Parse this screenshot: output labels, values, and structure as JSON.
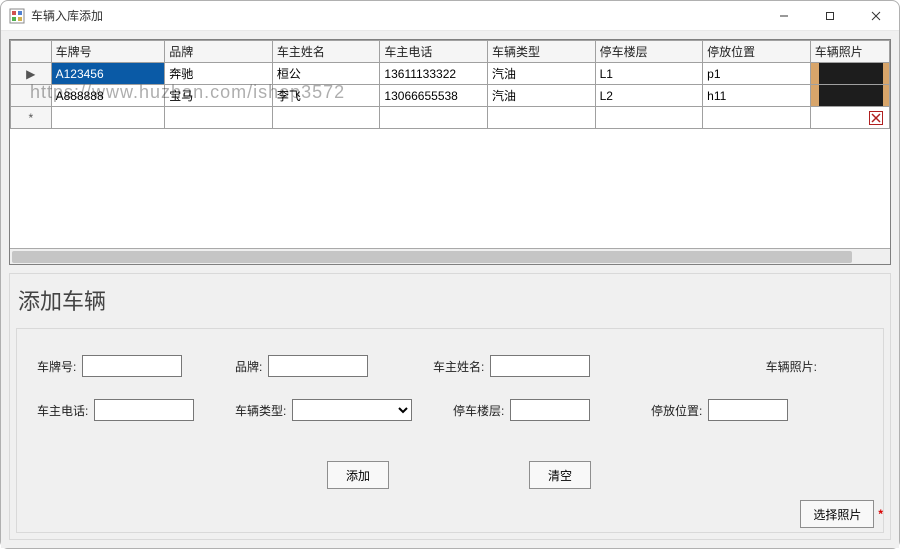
{
  "window": {
    "title": "车辆入库添加"
  },
  "grid": {
    "columns": [
      "车牌号",
      "品牌",
      "车主姓名",
      "车主电话",
      "车辆类型",
      "停车楼层",
      "停放位置",
      "车辆照片"
    ],
    "rows": [
      {
        "plate": "A123456",
        "brand": "奔驰",
        "owner": "桓公",
        "phone": "13611133322",
        "type": "汽油",
        "floor": "L1",
        "slot": "p1",
        "photo": "thumb",
        "selected": true,
        "current": true
      },
      {
        "plate": "A888888",
        "brand": "宝马",
        "owner": "李飞",
        "phone": "13066655538",
        "type": "汽油",
        "floor": "L2",
        "slot": "h11",
        "photo": "thumb"
      },
      {
        "plate": "",
        "brand": "",
        "owner": "",
        "phone": "",
        "type": "",
        "floor": "",
        "slot": "",
        "photo": "broken",
        "newrow": true
      }
    ]
  },
  "watermark": "https://www.huzhan.com/ishop3572",
  "form": {
    "title": "添加车辆",
    "labels": {
      "plate": "车牌号:",
      "brand": "品牌:",
      "owner": "车主姓名:",
      "photo": "车辆照片:",
      "phone": "车主电话:",
      "type": "车辆类型:",
      "floor": "停车楼层:",
      "slot": "停放位置:"
    },
    "values": {
      "plate": "",
      "brand": "",
      "owner": "",
      "phone": "",
      "type": "",
      "floor": "",
      "slot": ""
    },
    "typeOptions": [
      ""
    ],
    "buttons": {
      "add": "添加",
      "clear": "清空",
      "choose": "选择照片"
    }
  }
}
